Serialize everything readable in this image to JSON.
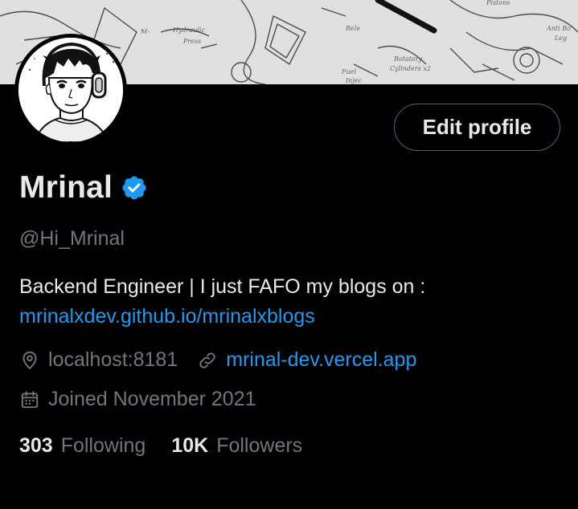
{
  "profile": {
    "name": "Mrinal",
    "handle": "@Hi_Mrinal",
    "bio_text": "Backend Engineer | I just FAFO my blogs on :",
    "bio_link": "mrinalxdev.github.io/mrinalxblogs",
    "location": "localhost:8181",
    "website": "mrinal-dev.vercel.app",
    "joined": "Joined November 2021",
    "following_count": "303",
    "following_label": "Following",
    "followers_count": "10K",
    "followers_label": "Followers"
  },
  "actions": {
    "edit_profile_label": "Edit profile"
  },
  "icons": {
    "verified": "verified-badge-icon",
    "location": "location-pin-icon",
    "link": "link-icon",
    "calendar": "calendar-icon"
  },
  "colors": {
    "background": "#000000",
    "primary_text": "#e7e9ea",
    "secondary_text": "#71767b",
    "link": "#1d9bf0",
    "verified_badge": "#1d9bf0",
    "button_border": "#536471"
  }
}
